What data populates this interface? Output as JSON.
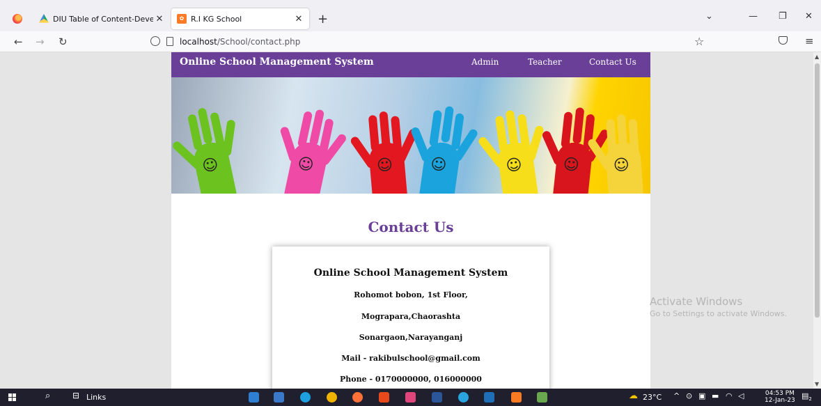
{
  "browser": {
    "tabs": [
      {
        "label": "DIU Table of Content-Developm",
        "icon": "google-drive-icon"
      },
      {
        "label": "R.I KG School",
        "icon": "xampp-icon",
        "active": true
      }
    ],
    "url_host": "localhost",
    "url_path": "/School/contact.php"
  },
  "site": {
    "brand": "Online School Management System",
    "nav": [
      "Admin",
      "Teacher",
      "Contact Us"
    ],
    "header_color": "#6a3f97"
  },
  "contact": {
    "title": "Contact Us",
    "org": "Online School Management System",
    "lines": [
      "Rohomot bobon, 1st Floor,",
      "Mograpara,Chaorashta",
      "Sonargaon,Narayanganj",
      "Mail - rakibulschool@gmail.com",
      "Phone - 0170000000, 016000000"
    ]
  },
  "watermark": {
    "title": "Activate Windows",
    "subtitle": "Go to Settings to activate Windows."
  },
  "taskbar": {
    "links_label": "Links",
    "temperature": "23°C",
    "time": "04:53 PM",
    "date": "12-Jan-23",
    "notification_count": "2"
  }
}
